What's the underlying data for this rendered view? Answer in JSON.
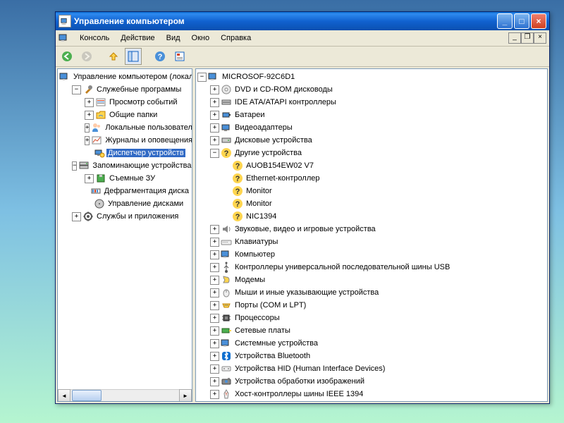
{
  "window": {
    "title": "Управление компьютером"
  },
  "menu": {
    "console": "Консоль",
    "action": "Действие",
    "view": "Вид",
    "window": "Окно",
    "help": "Справка"
  },
  "left_tree": {
    "root": "Управление компьютером (локальным)",
    "system_tools": "Служебные программы",
    "event_viewer": "Просмотр событий",
    "shared_folders": "Общие папки",
    "local_users": "Локальные пользователи",
    "perf_logs": "Журналы и оповещения пр",
    "device_manager": "Диспетчер устройств",
    "storage": "Запоминающие устройства",
    "removable": "Съемные ЗУ",
    "defrag": "Дефрагментация диска",
    "disk_mgmt": "Управление дисками",
    "services": "Службы и приложения"
  },
  "right_tree": {
    "root": "MICROSOF-92C6D1",
    "dvd": "DVD и CD-ROM дисководы",
    "ide": "IDE ATA/ATAPI контроллеры",
    "batteries": "Батареи",
    "video_adapters": "Видеоадаптеры",
    "disk_drives": "Дисковые устройства",
    "other_devices": "Другие устройства",
    "other_items": {
      "auo": "AUOB154EW02 V7",
      "ethernet": "Ethernet-контроллер",
      "monitor1": "Monitor",
      "monitor2": "Monitor",
      "nic": "NIC1394"
    },
    "sound": "Звуковые, видео и игровые устройства",
    "keyboards": "Клавиатуры",
    "computer": "Компьютер",
    "usb": "Контроллеры универсальной последовательной шины USB",
    "modems": "Модемы",
    "mice": "Мыши и иные указывающие устройства",
    "ports": "Порты (COM и LPT)",
    "processors": "Процессоры",
    "network": "Сетевые платы",
    "system": "Системные устройства",
    "bluetooth": "Устройства Bluetooth",
    "hid": "Устройства HID (Human Interface Devices)",
    "imaging": "Устройства обработки изображений",
    "ieee1394": "Хост-контроллеры шины IEEE 1394"
  }
}
